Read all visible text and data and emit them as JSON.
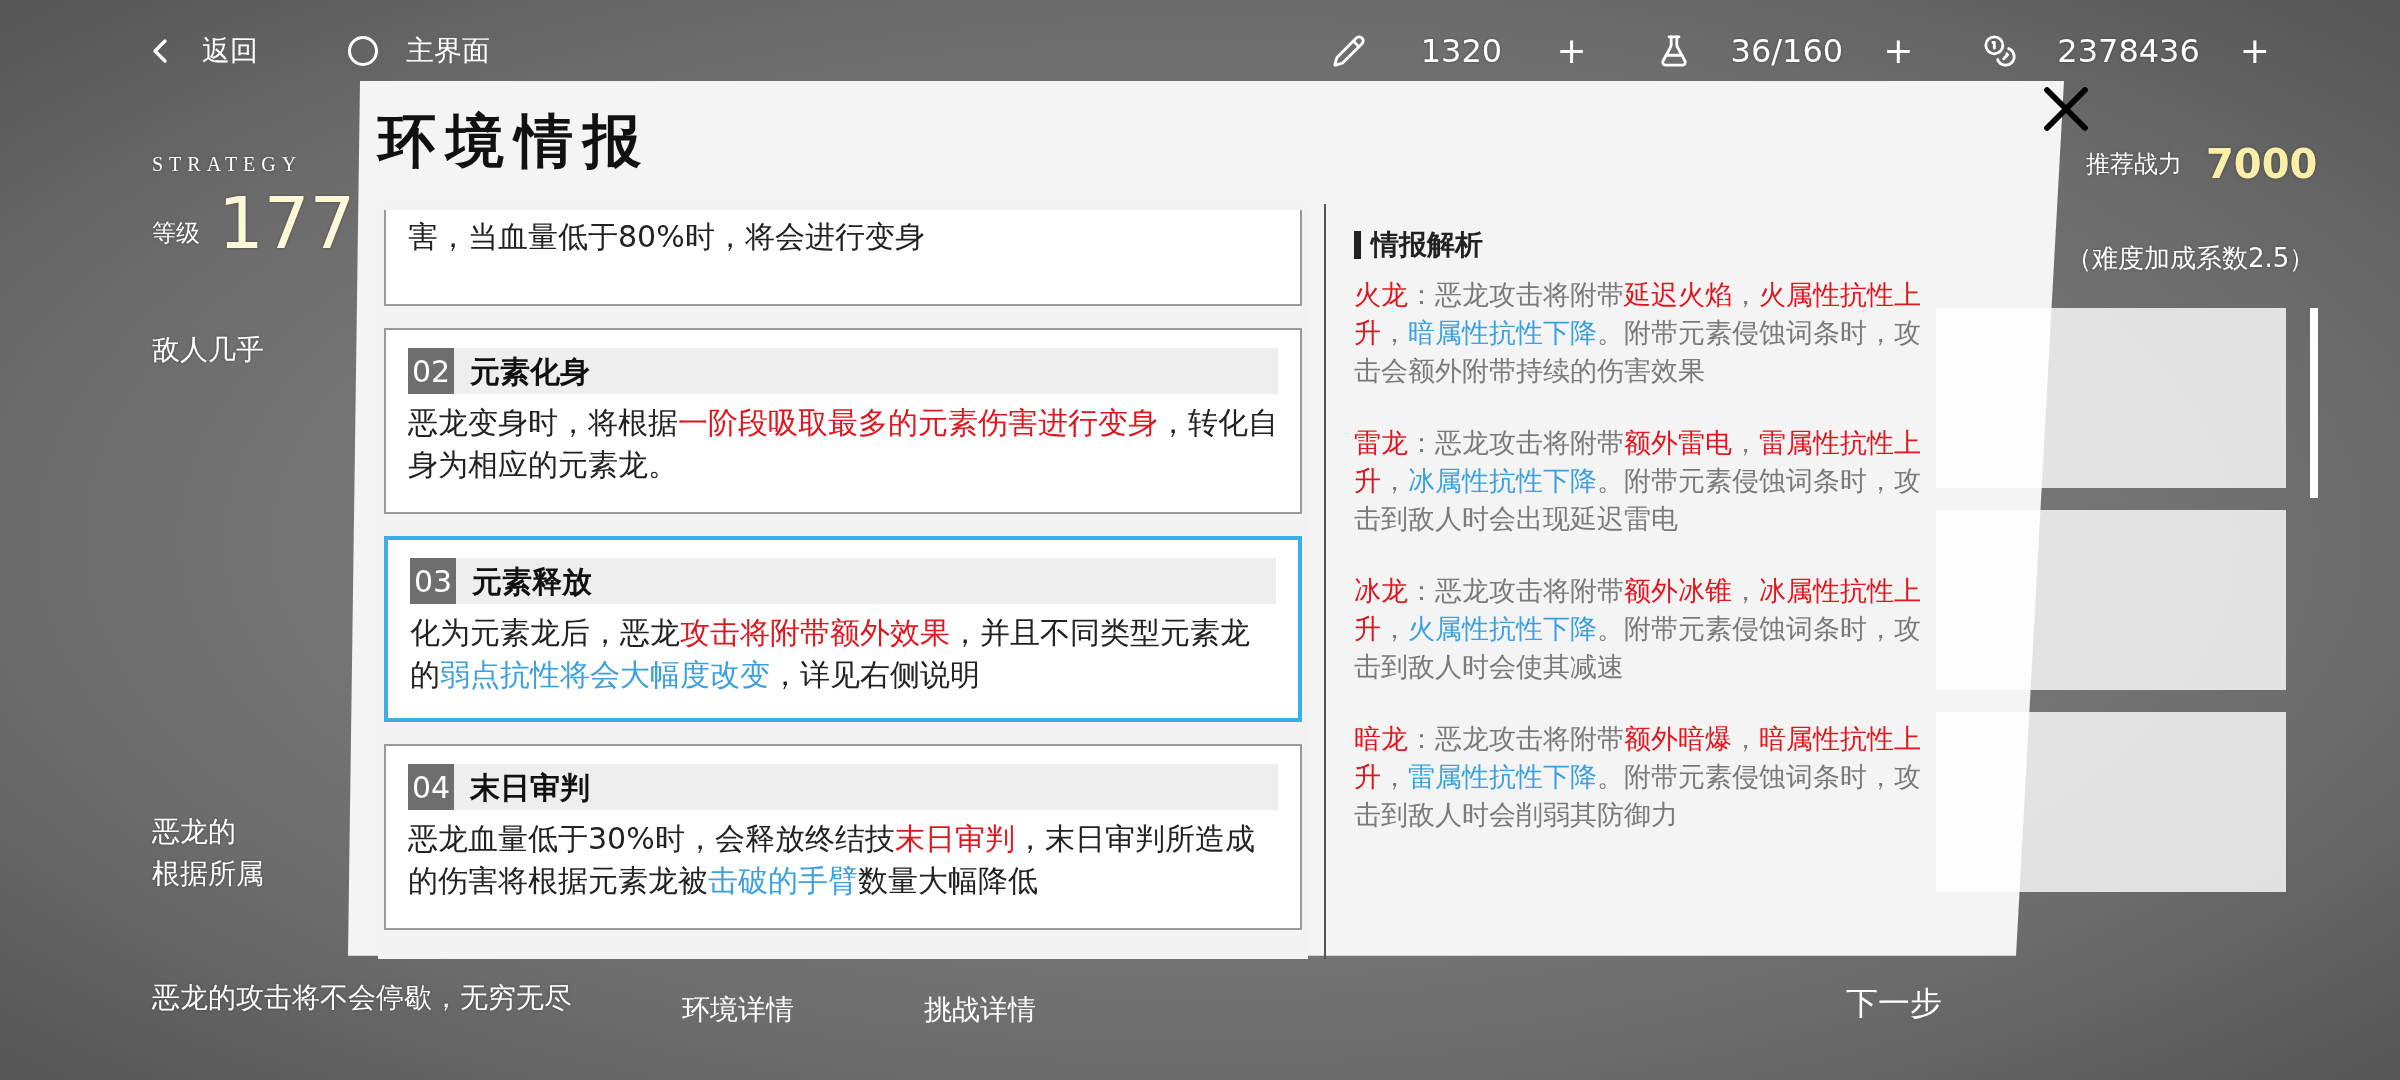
{
  "top_bar": {
    "back_label": "返回",
    "home_label": "主界面",
    "resources": [
      {
        "value": "1320",
        "plus": "+"
      },
      {
        "value": "36/160",
        "plus": "+"
      },
      {
        "value": "2378436",
        "plus": "+"
      }
    ]
  },
  "title": "环境情报",
  "background_panel": {
    "tag": "STRATEGY",
    "level_label": "等级",
    "level_value": "177",
    "lines": [
      "敌人几乎",
      "恶龙的",
      "根据所属"
    ],
    "footer": "恶龙的攻击将不会停歇，无穷无尽"
  },
  "cards": [
    {
      "selected": false,
      "body": [
        {
          "kind": "plain",
          "text": "害，当血量低于80%时，将会进行变身"
        }
      ]
    },
    {
      "number": "02",
      "title": "元素化身",
      "selected": false,
      "body": [
        {
          "kind": "plain",
          "text": "恶龙变身时，将根据"
        },
        {
          "kind": "red",
          "text": "一阶段吸取最多的元素伤害进行变身"
        },
        {
          "kind": "plain",
          "text": "，转化自身为相应的元素龙。"
        }
      ]
    },
    {
      "number": "03",
      "title": "元素释放",
      "selected": true,
      "body": [
        {
          "kind": "plain",
          "text": "化为元素龙后，恶龙"
        },
        {
          "kind": "red",
          "text": "攻击将附带额外效果"
        },
        {
          "kind": "plain",
          "text": "，并且不同类型元素龙的"
        },
        {
          "kind": "blue",
          "text": "弱点抗性将会大幅度改变"
        },
        {
          "kind": "plain",
          "text": "，详见右侧说明"
        }
      ]
    },
    {
      "number": "04",
      "title": "末日审判",
      "selected": false,
      "body": [
        {
          "kind": "plain",
          "text": "恶龙血量低于30%时，会释放终结技"
        },
        {
          "kind": "red",
          "text": "末日审判"
        },
        {
          "kind": "plain",
          "text": "，末日审判所造成的伤害将根据元素龙被"
        },
        {
          "kind": "blue",
          "text": "击破的手臂"
        },
        {
          "kind": "plain",
          "text": "数量大幅降低"
        }
      ]
    }
  ],
  "info": {
    "heading": "情报解析",
    "entries": [
      {
        "segments": [
          {
            "kind": "red",
            "text": "火龙"
          },
          {
            "kind": "plain",
            "text": "：恶龙攻击将附带"
          },
          {
            "kind": "red",
            "text": "延迟火焰"
          },
          {
            "kind": "plain",
            "text": "，"
          },
          {
            "kind": "red",
            "text": "火属性抗性上升"
          },
          {
            "kind": "plain",
            "text": "，"
          },
          {
            "kind": "blue",
            "text": "暗属性抗性下降"
          },
          {
            "kind": "plain",
            "text": "。附带元素侵蚀词条时，攻击会额外附带持续的伤害效果"
          }
        ]
      },
      {
        "segments": [
          {
            "kind": "red",
            "text": "雷龙"
          },
          {
            "kind": "plain",
            "text": "：恶龙攻击将附带"
          },
          {
            "kind": "red",
            "text": "额外雷电"
          },
          {
            "kind": "plain",
            "text": "，"
          },
          {
            "kind": "red",
            "text": "雷属性抗性上升"
          },
          {
            "kind": "plain",
            "text": "，"
          },
          {
            "kind": "blue",
            "text": "冰属性抗性下降"
          },
          {
            "kind": "plain",
            "text": "。附带元素侵蚀词条时，攻击到敌人时会出现延迟雷电"
          }
        ]
      },
      {
        "segments": [
          {
            "kind": "red",
            "text": "冰龙"
          },
          {
            "kind": "plain",
            "text": "：恶龙攻击将附带"
          },
          {
            "kind": "red",
            "text": "额外冰锥"
          },
          {
            "kind": "plain",
            "text": "，"
          },
          {
            "kind": "red",
            "text": "冰属性抗性上升"
          },
          {
            "kind": "plain",
            "text": "，"
          },
          {
            "kind": "blue",
            "text": "火属性抗性下降"
          },
          {
            "kind": "plain",
            "text": "。附带元素侵蚀词条时，攻击到敌人时会使其减速"
          }
        ]
      },
      {
        "segments": [
          {
            "kind": "red",
            "text": "暗龙"
          },
          {
            "kind": "plain",
            "text": "：恶龙攻击将附带"
          },
          {
            "kind": "red",
            "text": "额外暗爆"
          },
          {
            "kind": "plain",
            "text": "，"
          },
          {
            "kind": "red",
            "text": "暗属性抗性上升"
          },
          {
            "kind": "plain",
            "text": "，"
          },
          {
            "kind": "blue",
            "text": "雷属性抗性下降"
          },
          {
            "kind": "plain",
            "text": "。附带元素侵蚀词条时，攻击到敌人时会削弱其防御力"
          }
        ]
      }
    ]
  },
  "recommend": {
    "label": "推荐战力",
    "value": "7000",
    "note": "（难度加成系数2.5）"
  },
  "bottom_tabs": [
    "环境详情",
    "挑战详情"
  ],
  "next_label": "下一步"
}
